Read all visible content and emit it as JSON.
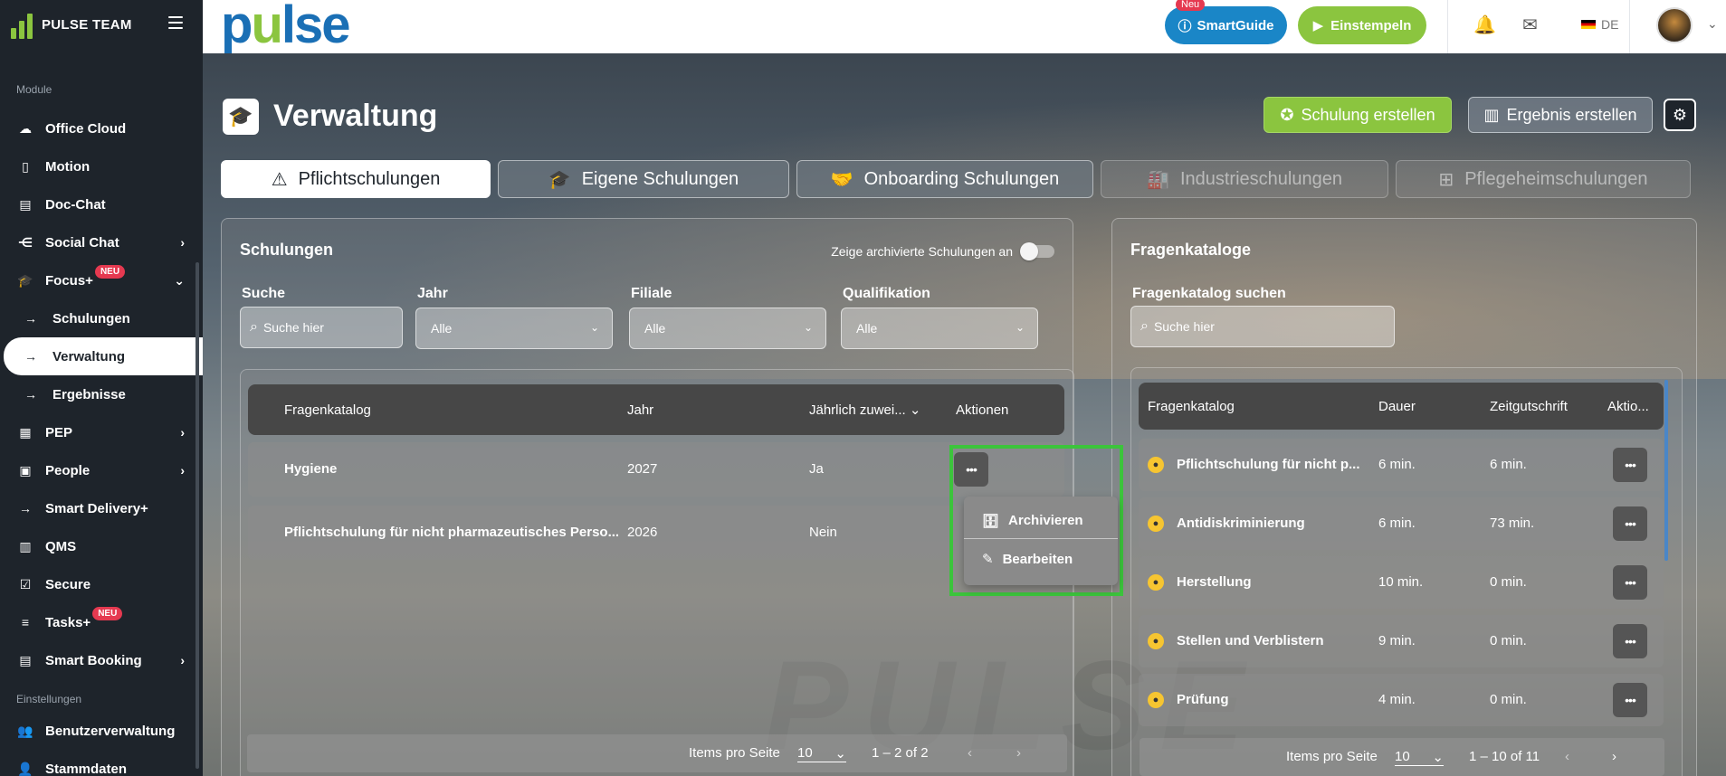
{
  "brand": {
    "name": "PULSE TEAM",
    "logo_text_a": "p",
    "logo_text_u": "u",
    "logo_text_b": "lse"
  },
  "header": {
    "smartguide_badge": "Neu",
    "smartguide_label": "SmartGuide",
    "stamp_label": "Einstempeln",
    "lang": "DE"
  },
  "sidebar": {
    "section_modules": "Module",
    "section_settings": "Einstellungen",
    "items": [
      {
        "label": "Office Cloud"
      },
      {
        "label": "Motion"
      },
      {
        "label": "Doc-Chat"
      },
      {
        "label": "Social Chat"
      },
      {
        "label": "Focus+",
        "badge": "NEU"
      },
      {
        "label": "Schulungen"
      },
      {
        "label": "Verwaltung"
      },
      {
        "label": "Ergebnisse"
      },
      {
        "label": "PEP"
      },
      {
        "label": "People"
      },
      {
        "label": "Smart Delivery+"
      },
      {
        "label": "QMS"
      },
      {
        "label": "Secure"
      },
      {
        "label": "Tasks+",
        "badge": "NEU"
      },
      {
        "label": "Smart Booking"
      }
    ],
    "settings_items": [
      {
        "label": "Benutzerverwaltung"
      },
      {
        "label": "Stammdaten"
      }
    ]
  },
  "page": {
    "title": "Verwaltung",
    "btn_create_training": "Schulung erstellen",
    "btn_create_result": "Ergebnis erstellen"
  },
  "tabs": [
    {
      "label": "Pflichtschulungen"
    },
    {
      "label": "Eigene Schulungen"
    },
    {
      "label": "Onboarding Schulungen"
    },
    {
      "label": "Industrieschulungen"
    },
    {
      "label": "Pflegeheimschulungen"
    }
  ],
  "trainings": {
    "title": "Schulungen",
    "archive_toggle_label": "Zeige archivierte Schulungen an",
    "search_label": "Suche",
    "search_placeholder": "Suche hier",
    "year_label": "Jahr",
    "year_value": "Alle",
    "branch_label": "Filiale",
    "branch_value": "Alle",
    "qual_label": "Qualifikation",
    "qual_value": "Alle",
    "columns": {
      "catalog": "Fragenkatalog",
      "year": "Jahr",
      "yearly": "Jährlich zuwei...",
      "actions": "Aktionen"
    },
    "rows": [
      {
        "catalog": "Hygiene",
        "year": "2027",
        "yearly": "Ja"
      },
      {
        "catalog": "Pflichtschulung für nicht pharmazeutisches Perso...",
        "year": "2026",
        "yearly": "Nein"
      }
    ],
    "pager": {
      "label": "Items pro Seite",
      "size": "10",
      "range": "1 – 2 of 2"
    }
  },
  "menu": {
    "archive": "Archivieren",
    "edit": "Bearbeiten"
  },
  "catalogs": {
    "title": "Fragenkataloge",
    "search_label": "Fragenkatalog suchen",
    "search_placeholder": "Suche hier",
    "columns": {
      "catalog": "Fragenkatalog",
      "duration": "Dauer",
      "credit": "Zeitgutschrift",
      "actions": "Aktio..."
    },
    "rows": [
      {
        "catalog": "Pflichtschulung für nicht p...",
        "duration": "6 min.",
        "credit": "6 min."
      },
      {
        "catalog": "Antidiskriminierung",
        "duration": "6 min.",
        "credit": "73 min."
      },
      {
        "catalog": "Herstellung",
        "duration": "10 min.",
        "credit": "0 min."
      },
      {
        "catalog": "Stellen und Verblistern",
        "duration": "9 min.",
        "credit": "0 min."
      },
      {
        "catalog": "Prüfung",
        "duration": "4 min.",
        "credit": "0 min."
      }
    ],
    "pager": {
      "label": "Items pro Seite",
      "size": "10",
      "range": "1 – 10 of 11"
    }
  },
  "colors": {
    "accent_green": "#8bc53f",
    "brand_blue": "#1a6fb5",
    "highlight": "#3cc43c",
    "badge_red": "#e53950"
  }
}
